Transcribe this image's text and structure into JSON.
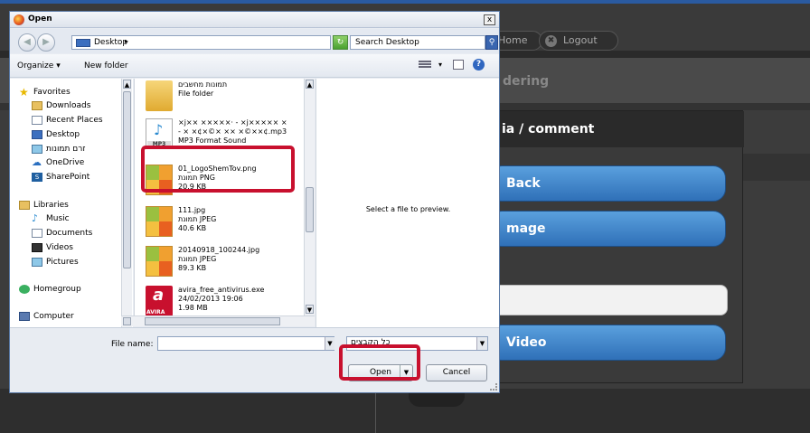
{
  "app": {
    "nav_home": "Home",
    "nav_logout": "Logout",
    "subheader_fragment": "dering",
    "modal": {
      "title_fragment": "ia / comment",
      "btn_back": "Back",
      "btn_image_fragment": "mage",
      "btn_video": "Video"
    }
  },
  "dialog": {
    "title": "Open",
    "close_glyph": "x",
    "address": "Desktop",
    "search_placeholder": "Search Desktop",
    "toolbar": {
      "organize": "Organize",
      "new_folder": "New folder"
    },
    "nav_items": {
      "favorites": "Favorites",
      "downloads": "Downloads",
      "recent_places": "Recent Places",
      "desktop": "Desktop",
      "zorem": "זרם תמונות",
      "onedrive": "OneDrive",
      "sharepoint": "SharePoint",
      "libraries": "Libraries",
      "music": "Music",
      "documents": "Documents",
      "videos": "Videos",
      "pictures": "Pictures",
      "homegroup": "Homegroup",
      "computer": "Computer"
    },
    "files": [
      {
        "name": "תמונות מחשבים",
        "type": "File folder",
        "size": ""
      },
      {
        "name": "×j×× ×××××· - ×j××××× ×",
        "name2": "- × ×¢×©× ×× ×©××¢.mp3",
        "type": "MP3 Format Sound"
      },
      {
        "name": "01_LogoShemTov.png",
        "type": "תמונת PNG",
        "size": "20.9 KB"
      },
      {
        "name": "111.jpg",
        "type": "תמונת JPEG",
        "size": "40.6 KB"
      },
      {
        "name": "20140918_100244.jpg",
        "type": "תמונת JPEG",
        "size": "89.3 KB"
      },
      {
        "name": "avira_free_antivirus.exe",
        "type": "24/02/2013 19:06",
        "size": "1.98 MB"
      }
    ],
    "preview_text": "Select a file to preview.",
    "file_name_label": "File name:",
    "file_name_value": "",
    "filter_value": "כל הקבצים",
    "open_button": "Open",
    "cancel_button": "Cancel",
    "mp3_label": "MP3",
    "avira_label": "AVIRA"
  },
  "colors": {
    "highlight": "#c8102e",
    "modal_button": "#3a82cc"
  }
}
